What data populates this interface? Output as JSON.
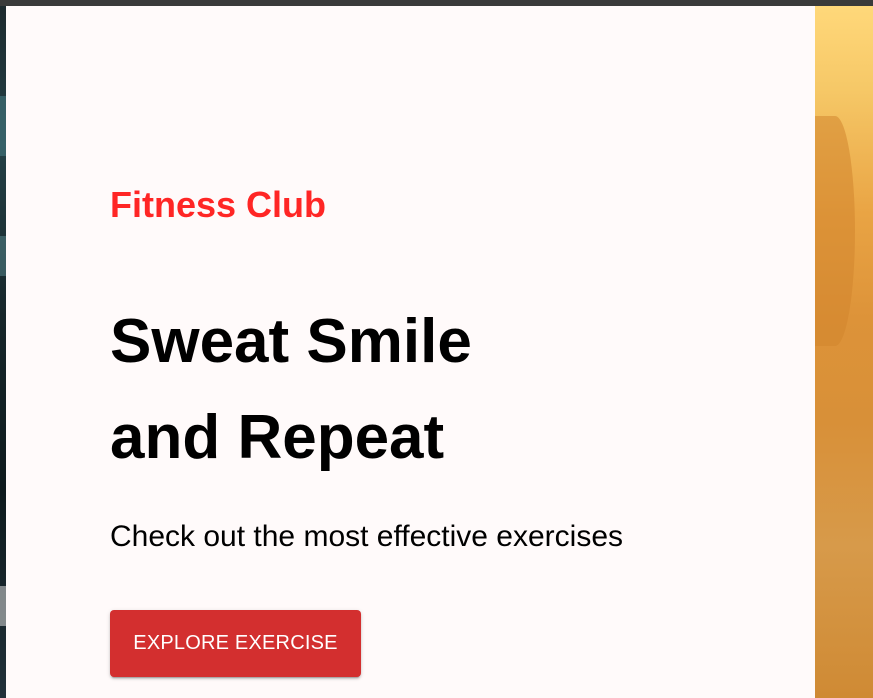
{
  "hero": {
    "eyebrow": "Fitness Club",
    "headline_line1": "Sweat Smile",
    "headline_line2": "and Repeat",
    "subtext": "Check out the most effective exercises",
    "cta_label": "EXPLORE EXERCISE"
  },
  "colors": {
    "accent": "#ff2625",
    "button": "#d32f2f",
    "panel_background": "#fffafa"
  }
}
